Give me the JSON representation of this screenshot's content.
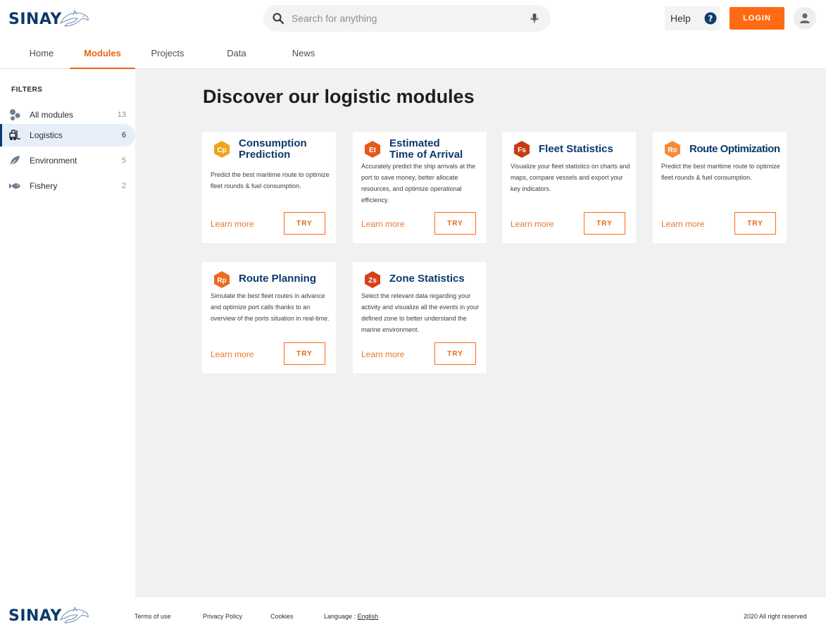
{
  "brand": {
    "name": "SINAY",
    "color": "#0c3a6b",
    "accent": "#ff6a13"
  },
  "header": {
    "search_placeholder": "Search for anything",
    "help_label": "Help",
    "login_label": "LOGIN"
  },
  "nav": {
    "tabs": [
      {
        "label": "Home",
        "active": false
      },
      {
        "label": "Modules",
        "active": true
      },
      {
        "label": "Projects",
        "active": false
      },
      {
        "label": "Data",
        "active": false
      },
      {
        "label": "News",
        "active": false
      }
    ]
  },
  "sidebar": {
    "title": "FILTERS",
    "filters": [
      {
        "label": "All modules",
        "count": "13",
        "icon": "bubbles-icon",
        "active": false
      },
      {
        "label": "Logistics",
        "count": "6",
        "icon": "forklift-icon",
        "active": true
      },
      {
        "label": "Environment",
        "count": "5",
        "icon": "leaf-icon",
        "active": false
      },
      {
        "label": "Fishery",
        "count": "2",
        "icon": "fish-icon",
        "active": false
      }
    ]
  },
  "main": {
    "title": "Discover our logistic modules",
    "cards": [
      {
        "badge": "Cp",
        "badge_color": "#f0a31a",
        "title_line1": "Consumption",
        "title_line2": "Prediction",
        "description": "Predict the best maritime route to optimize fleet rounds & fuel consumption.",
        "learn_more": "Learn more",
        "try": "TRY"
      },
      {
        "badge": "Et",
        "badge_color": "#e8561a",
        "title_line1": "Estimated",
        "title_line2": "Time of Arrival",
        "description": "Accurately predict the ship arrivals at the port to save money, better allocate resources, and optimize operational efficiency.",
        "learn_more": "Learn more",
        "try": "TRY"
      },
      {
        "badge": "Fs",
        "badge_color": "#c83a12",
        "title_line1": "Fleet Statistics",
        "title_line2": "",
        "description": "Visualize your fleet statistics on charts and maps, compare vessels and export your key indicators.",
        "learn_more": "Learn more",
        "try": "TRY"
      },
      {
        "badge": "Ro",
        "badge_color": "#f58a3a",
        "title_line1": "Route Optimization",
        "title_line2": "",
        "description": "Predict the best maritime route to optimize fleet rounds & fuel consumption.",
        "learn_more": "Learn more",
        "try": "TRY"
      },
      {
        "badge": "Rp",
        "badge_color": "#ee6a1e",
        "title_line1": "Route Planning",
        "title_line2": "",
        "description": "Simulate the best fleet routes in advance and optimize port calls thanks to an overview of the ports situation in real-time.",
        "learn_more": "Learn more",
        "try": "TRY"
      },
      {
        "badge": "Zs",
        "badge_color": "#d9401a",
        "title_line1": "Zone Statistics",
        "title_line2": "",
        "description": "Select the relevant data regarding your activity and visualize all the events in your defined zone to better understand the marine environment.",
        "learn_more": "Learn more",
        "try": "TRY"
      }
    ]
  },
  "footer": {
    "terms": "Terms of use",
    "privacy": "Privacy Policy",
    "cookies": "Cookies",
    "language_label": "Language :",
    "language_value": "English",
    "copyright": "2020 All right reserved"
  }
}
